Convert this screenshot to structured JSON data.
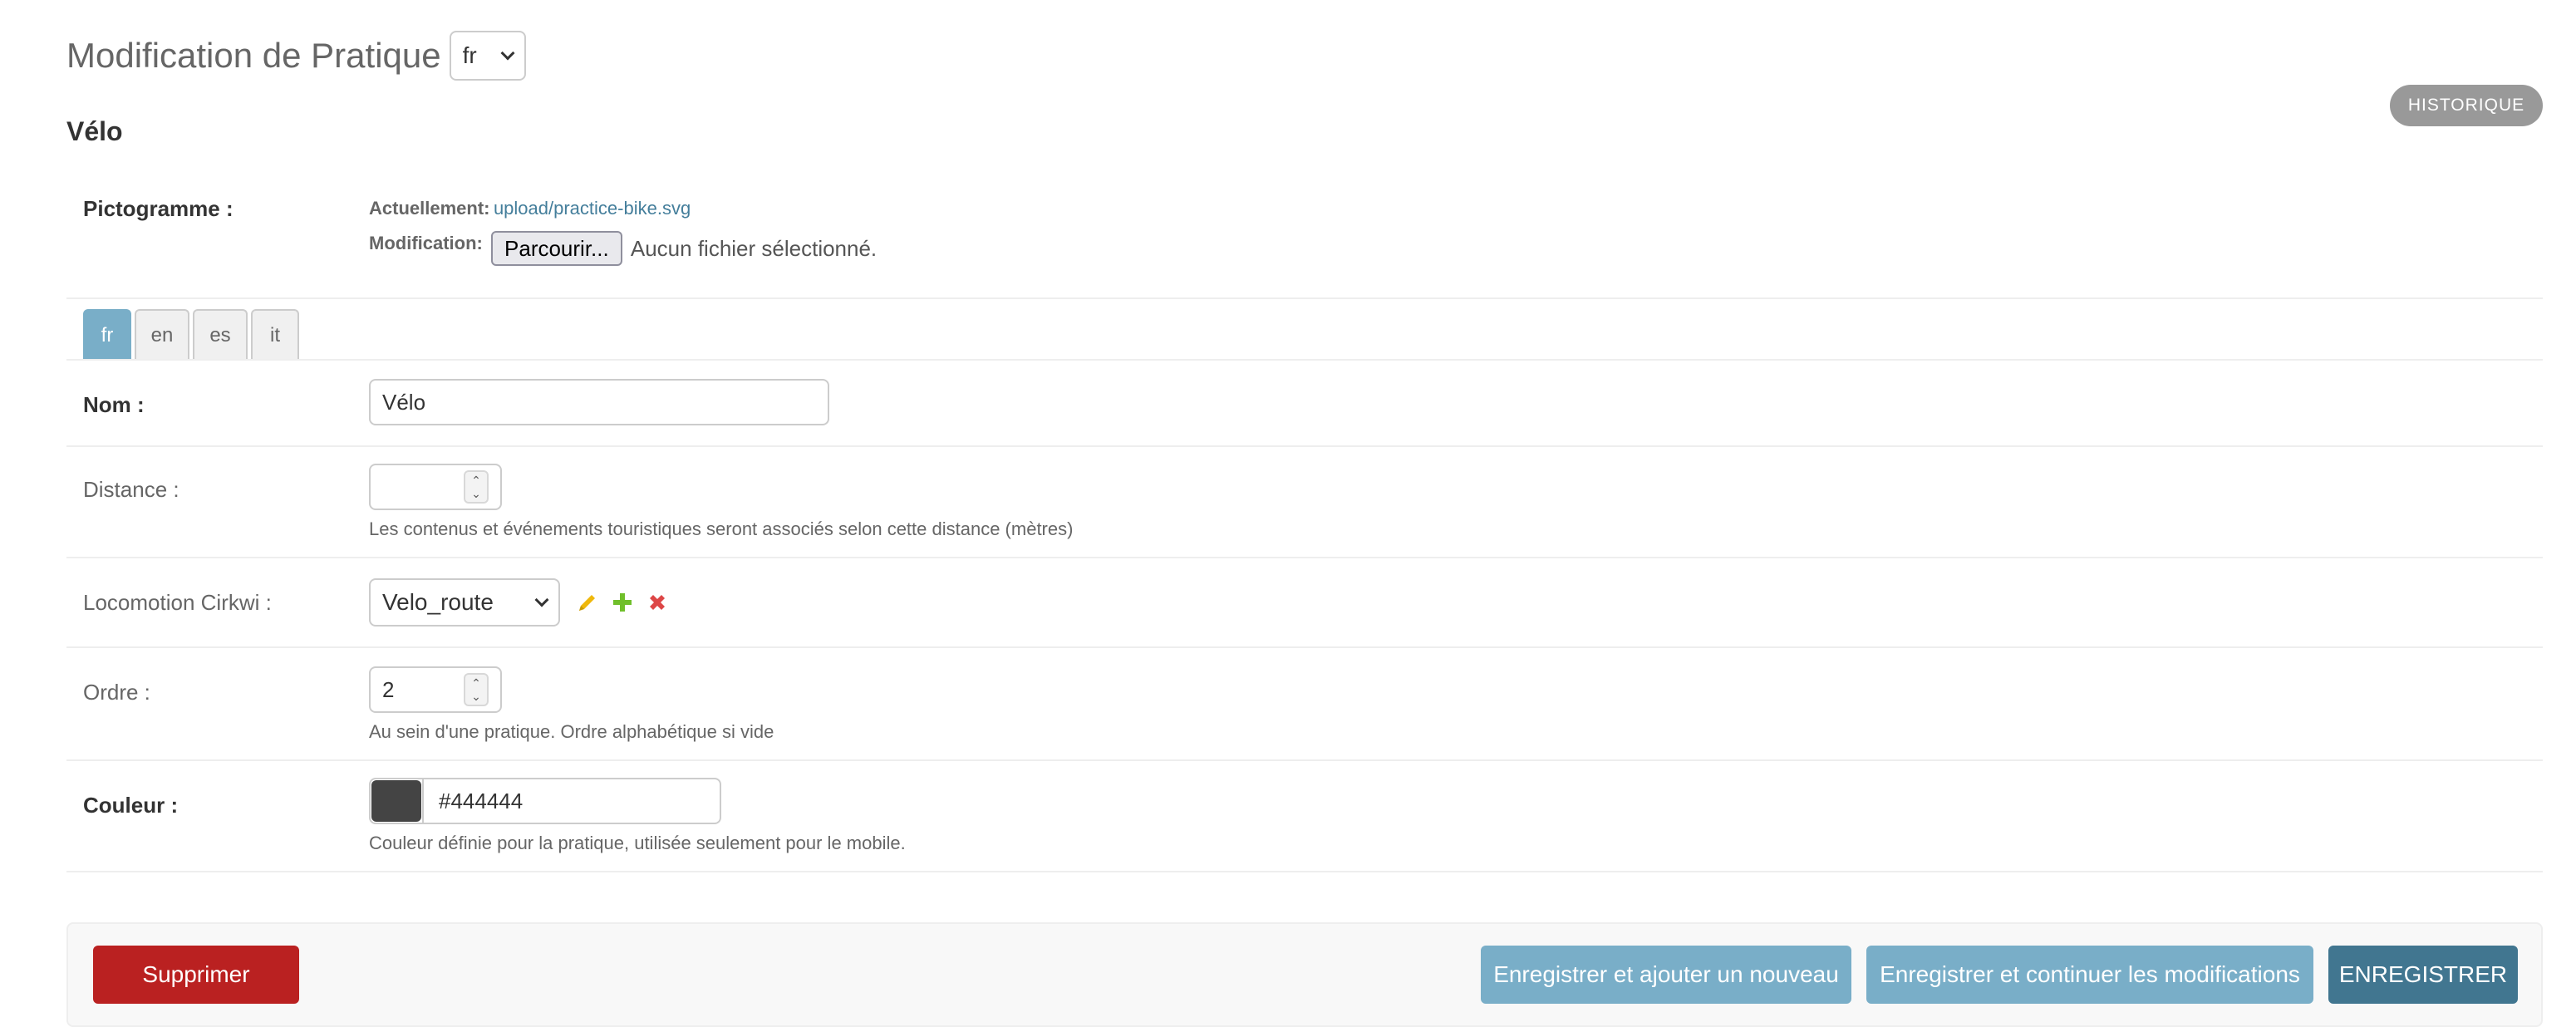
{
  "header": {
    "title": "Modification de Pratique",
    "language_selected": "fr"
  },
  "object_title": "Vélo",
  "history_button": "HISTORIQUE",
  "pictogram": {
    "label": "Pictogramme :",
    "current_label": "Actuellement:",
    "current_link": "upload/practice-bike.svg",
    "change_label": "Modification:",
    "browse_button": "Parcourir...",
    "file_status": "Aucun fichier sélectionné."
  },
  "tabs": [
    {
      "label": "fr",
      "active": true
    },
    {
      "label": "en",
      "active": false
    },
    {
      "label": "es",
      "active": false
    },
    {
      "label": "it",
      "active": false
    }
  ],
  "fields": {
    "nom": {
      "label": "Nom :",
      "value": "Vélo"
    },
    "distance": {
      "label": "Distance :",
      "value": "",
      "help": "Les contenus et événements touristiques seront associés selon cette distance (mètres)"
    },
    "locomotion": {
      "label": "Locomotion Cirkwi :",
      "value": "Velo_route",
      "icons": [
        "pencil-icon",
        "plus-icon",
        "delete-icon"
      ]
    },
    "ordre": {
      "label": "Ordre :",
      "value": "2",
      "help": "Au sein d'une pratique. Ordre alphabétique si vide"
    },
    "couleur": {
      "label": "Couleur :",
      "value": "#444444",
      "help": "Couleur définie pour la pratique, utilisée seulement pour le mobile."
    }
  },
  "actions": {
    "delete": "Supprimer",
    "save_add": "Enregistrer et ajouter un nouveau",
    "save_continue": "Enregistrer et continuer les modifications",
    "save": "ENREGISTRER"
  },
  "colors": {
    "accent": "#79aec8",
    "link": "#447e9b",
    "delete": "#ba2121",
    "save_primary": "#417690",
    "save_secondary": "#79aec8",
    "history": "#999999",
    "pencil": "#efb80b",
    "plus": "#70bf2b",
    "cross": "#dd4646"
  }
}
